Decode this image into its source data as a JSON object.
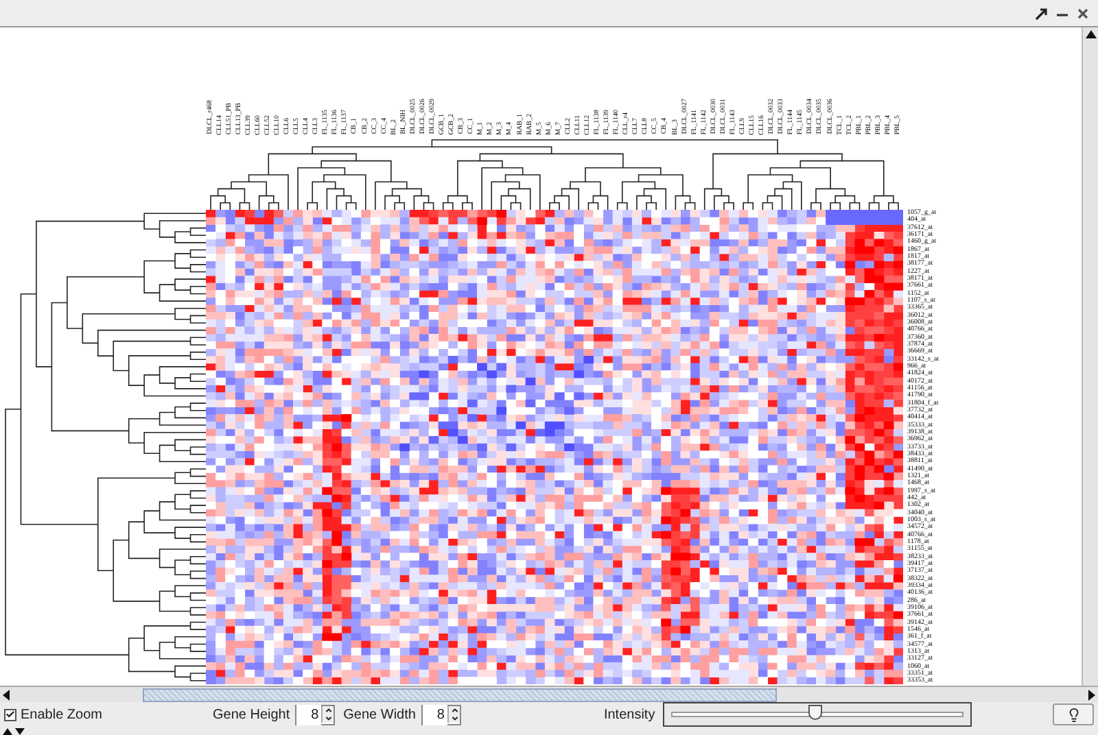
{
  "columns": [
    "DLCL_r468",
    "CLL14",
    "CLL51_PB",
    "CLL13_PB",
    "CLL39",
    "CLL60",
    "CLL52",
    "CLL10",
    "CLL6",
    "CLL5",
    "CLL4",
    "CLL3",
    "FL_1135",
    "FL_1136",
    "FL_1137",
    "CB_1",
    "CB_2",
    "CC_3",
    "CC_4",
    "BL_2",
    "BL_NIH",
    "DLCL_0025",
    "DLCL_0026",
    "DLCL_0029",
    "GCB_1",
    "GCB_2",
    "CB_3",
    "CC_1",
    "M_1",
    "M_2",
    "M_3",
    "M_4",
    "RAB_1",
    "RAB_2",
    "M_5",
    "M_6",
    "M_7",
    "CLL2",
    "CLL11",
    "CLL12",
    "FL_1138",
    "FL_1139",
    "FL_1140",
    "CLL_r4",
    "CLL7",
    "CLL8",
    "CC_5",
    "CB_4",
    "BL_3",
    "DLCL_0027",
    "FL_1141",
    "FL_1142",
    "DLCL_0030",
    "DLCL_0031",
    "FL_1143",
    "CLL9",
    "CLL15",
    "CLL16",
    "DLCL_0032",
    "DLCL_0033",
    "FL_1144",
    "FL_1145",
    "DLCL_0034",
    "DLCL_0035",
    "DLCL_0036",
    "TCL_1",
    "TCL_2",
    "PBL_1",
    "PBL_2",
    "PBL_3",
    "PBL_4",
    "PBL_5"
  ],
  "rows": [
    "1057_g_at",
    "404_at",
    "37612_at",
    "36171_at",
    "1460_g_at",
    "1867_at",
    "1817_at",
    "38177_at",
    "1227_at",
    "38171_at",
    "37661_at",
    "1152_at",
    "1107_s_at",
    "33365_at",
    "36012_at",
    "36008_at",
    "40766_at",
    "37360_at",
    "37874_at",
    "36669_at",
    "33142_s_at",
    "966_at",
    "41824_at",
    "40172_at",
    "41156_at",
    "41790_at",
    "31804_f_at",
    "37732_at",
    "40414_at",
    "35333_at",
    "39138_at",
    "36962_at",
    "33733_at",
    "38433_at",
    "38811_at",
    "41490_at",
    "1321_at",
    "1468_at",
    "1997_s_at",
    "442_at",
    "1302_at",
    "34040_at",
    "1003_s_at",
    "34572_at",
    "40766_at",
    "1178_at",
    "31155_at",
    "38233_at",
    "39417_at",
    "37137_at",
    "38322_at",
    "39334_at",
    "40136_at",
    "286_at",
    "39106_at",
    "37661_at",
    "39142_at",
    "1546_at",
    "361_f_at",
    "34577_at",
    "1313_at",
    "33127_at",
    "1060_at",
    "33351_at",
    "33353_at"
  ],
  "toolbar": {
    "enable_zoom": {
      "label": "Enable Zoom",
      "checked": true
    },
    "gene_height": {
      "label": "Gene Height",
      "value": "8"
    },
    "gene_width": {
      "label": "Gene Width",
      "value": "8"
    },
    "intensity": {
      "label": "Intensity",
      "level": 0.49
    }
  }
}
